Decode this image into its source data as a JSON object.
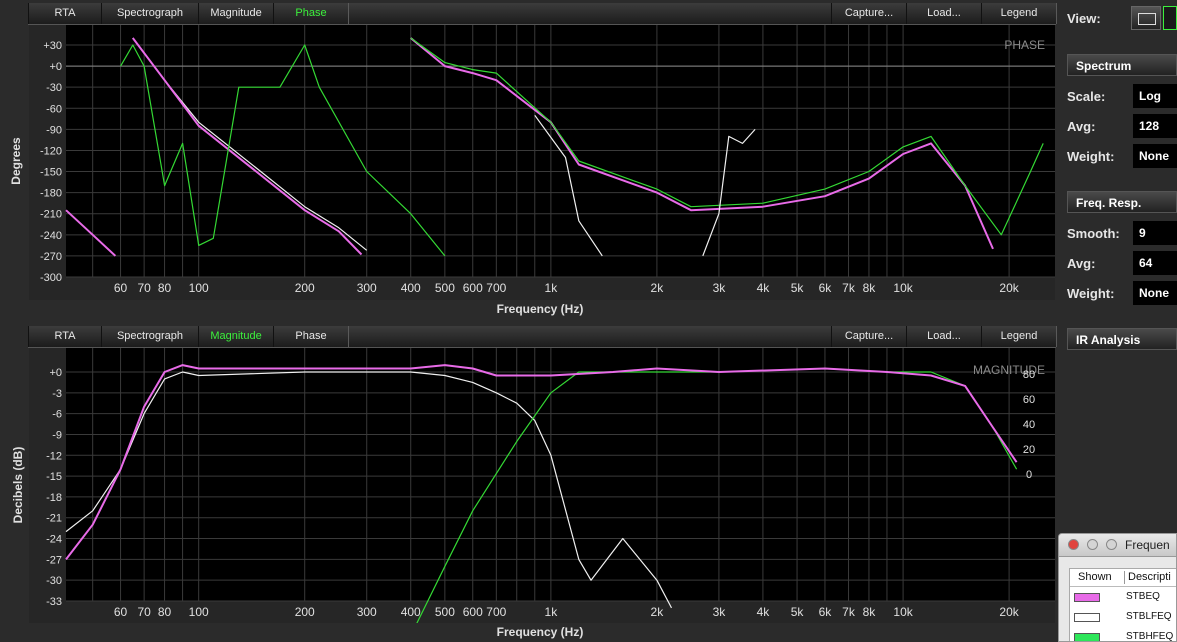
{
  "view_label": "View:",
  "tabs": [
    "RTA",
    "Spectrograph",
    "Magnitude",
    "Phase"
  ],
  "right_buttons": [
    "Capture...",
    "Load...",
    "Legend"
  ],
  "phase_panel": {
    "active_tab": "Phase",
    "watermark": "PHASE",
    "y_axis_label": "Degrees",
    "x_axis_label": "Frequency (Hz)",
    "y_ticks": [
      "+30",
      "+0",
      "-30",
      "-60",
      "-90",
      "-120",
      "-150",
      "-180",
      "-210",
      "-240",
      "-270",
      "-300"
    ]
  },
  "magnitude_panel": {
    "active_tab": "Magnitude",
    "watermark": "MAGNITUDE",
    "y_axis_label": "Decibels (dB)",
    "x_axis_label": "Frequency (Hz)",
    "y_ticks": [
      "+0",
      "-3",
      "-6",
      "-9",
      "-12",
      "-15",
      "-18",
      "-21",
      "-24",
      "-27",
      "-30",
      "-33"
    ],
    "right_ticks": [
      "80",
      "60",
      "40",
      "20",
      "0"
    ]
  },
  "x_ticks": [
    "60",
    "70",
    "80",
    "100",
    "200",
    "300",
    "400",
    "500",
    "600",
    "700",
    "1k",
    "2k",
    "3k",
    "4k",
    "5k",
    "6k",
    "7k",
    "8k",
    "10k",
    "20k"
  ],
  "sidebar": {
    "spectrum": {
      "header": "Spectrum",
      "scale_label": "Scale:",
      "scale_value": "Log",
      "avg_label": "Avg:",
      "avg_value": "128",
      "weight_label": "Weight:",
      "weight_value": "None"
    },
    "freq_resp": {
      "header": "Freq. Resp.",
      "smooth_label": "Smooth:",
      "smooth_value": "9",
      "avg_label": "Avg:",
      "avg_value": "64",
      "weight_label": "Weight:",
      "weight_value": "None"
    },
    "ir_analysis": "IR Analysis"
  },
  "legend_window": {
    "title": "Frequen",
    "col_shown": "Shown",
    "col_description": "Descripti",
    "rows": [
      {
        "name": "STBEQ",
        "color": "#e86be8"
      },
      {
        "name": "STBLFEQ",
        "color": "#ffffff"
      },
      {
        "name": "STBHFEQ",
        "color": "#2ee65a"
      }
    ]
  },
  "colors": {
    "magenta": "#e86be8",
    "white": "#f0f0f0",
    "green": "#34d834",
    "grid": "#3a3a3a"
  }
}
